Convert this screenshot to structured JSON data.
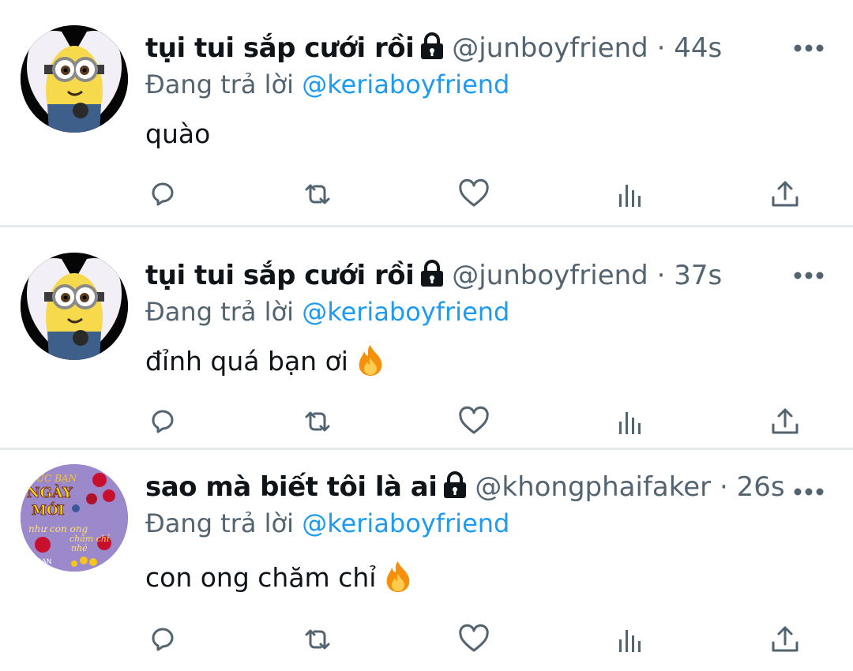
{
  "colors": {
    "text_primary": "#0f1419",
    "text_secondary": "#536471",
    "link": "#1d9bf0",
    "divider": "#e6e9eb",
    "fire": "#f4900c"
  },
  "icons": {
    "lock": "lock-icon",
    "more": "more-icon",
    "reply": "reply-icon",
    "retweet": "retweet-icon",
    "like": "heart-icon",
    "views": "views-icon",
    "share": "share-icon",
    "fire": "fire-emoji-icon"
  },
  "tweets": [
    {
      "display_name": "tụi tui sắp cưới rồi",
      "handle": "@junboyfriend",
      "separator": "·",
      "time": "44s",
      "reply_prefix": "Đang trả lời",
      "reply_to": "@keriaboyfriend",
      "text": "quào",
      "has_fire": false,
      "avatar": "minion-avatar"
    },
    {
      "display_name": "tụi tui sắp cưới rồi",
      "handle": "@junboyfriend",
      "separator": "·",
      "time": "37s",
      "reply_prefix": "Đang trả lời",
      "reply_to": "@keriaboyfriend",
      "text": "đỉnh quá bạn ơi",
      "has_fire": true,
      "avatar": "minion-avatar"
    },
    {
      "display_name": "sao mà biết tôi là ai",
      "handle": "@khongphaifaker",
      "separator": "·",
      "time": "26s",
      "reply_prefix": "Đang trả lời",
      "reply_to": "@keriaboyfriend",
      "text": "con ong chăm chỉ",
      "has_fire": true,
      "avatar": "flower-greeting-avatar",
      "avatar_text": [
        "ÚC BẠN",
        "NGÀY",
        "MỚI",
        "như con ong",
        "chăm chỉ",
        "nhé",
        "ME BẠN"
      ]
    }
  ]
}
